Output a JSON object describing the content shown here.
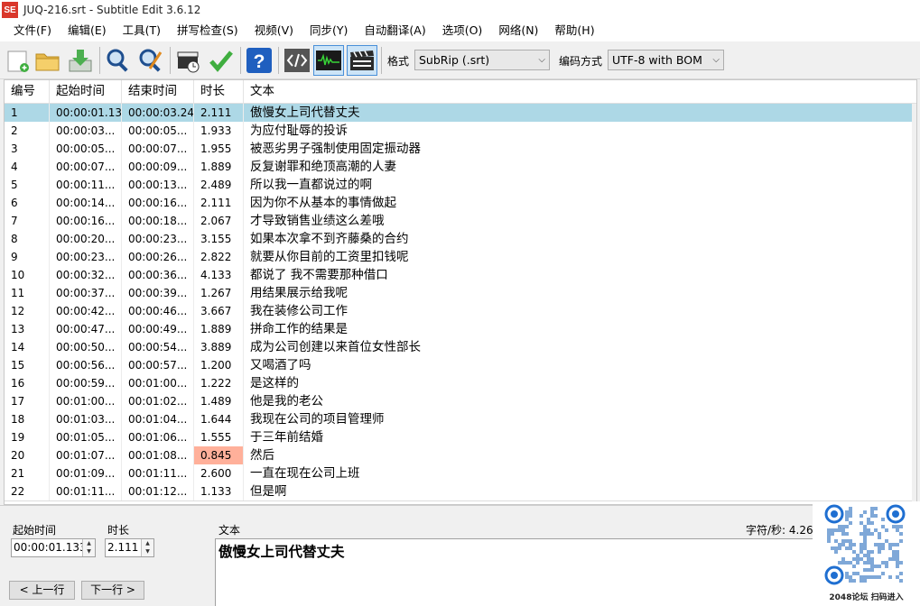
{
  "window": {
    "logo_text": "SE",
    "title": "JUQ-216.srt - Subtitle Edit 3.6.12"
  },
  "menu": [
    "文件(F)",
    "编辑(E)",
    "工具(T)",
    "拼写检查(S)",
    "视频(V)",
    "同步(Y)",
    "自动翻译(A)",
    "选项(O)",
    "网络(N)",
    "帮助(H)"
  ],
  "toolbar": {
    "buttons": [
      {
        "name": "new-file-icon"
      },
      {
        "name": "open-folder-icon"
      },
      {
        "name": "save-download-icon"
      },
      {
        "name": "find-icon"
      },
      {
        "name": "replace-icon"
      },
      {
        "name": "visual-sync-icon"
      },
      {
        "name": "spell-check-icon"
      },
      {
        "name": "help-icon"
      },
      {
        "name": "source-view-icon"
      },
      {
        "name": "waveform-icon"
      },
      {
        "name": "video-icon"
      }
    ],
    "format_label": "格式",
    "format_value": "SubRip (.srt)",
    "encoding_label": "编码方式",
    "encoding_value": "UTF-8 with BOM"
  },
  "grid": {
    "columns": [
      "编号",
      "起始时间",
      "结束时间",
      "时长",
      "文本"
    ],
    "rows": [
      [
        "1",
        "00:00:01.133",
        "00:00:03.244",
        "2.111",
        "傲慢女上司代替丈夫"
      ],
      [
        "2",
        "00:00:03...",
        "00:00:05...",
        "1.933",
        "为应付耻辱的投诉"
      ],
      [
        "3",
        "00:00:05...",
        "00:00:07...",
        "1.955",
        "被恶劣男子强制使用固定振动器"
      ],
      [
        "4",
        "00:00:07...",
        "00:00:09...",
        "1.889",
        "反复谢罪和绝顶高潮的人妻"
      ],
      [
        "5",
        "00:00:11...",
        "00:00:13...",
        "2.489",
        "所以我一直都说过的啊"
      ],
      [
        "6",
        "00:00:14...",
        "00:00:16...",
        "2.111",
        "因为你不从基本的事情做起"
      ],
      [
        "7",
        "00:00:16...",
        "00:00:18...",
        "2.067",
        "才导致销售业绩这么差哦"
      ],
      [
        "8",
        "00:00:20...",
        "00:00:23...",
        "3.155",
        "如果本次拿不到齐藤桑的合约"
      ],
      [
        "9",
        "00:00:23...",
        "00:00:26...",
        "2.822",
        "就要从你目前的工资里扣钱呢"
      ],
      [
        "10",
        "00:00:32...",
        "00:00:36...",
        "4.133",
        "都说了 我不需要那种借口"
      ],
      [
        "11",
        "00:00:37...",
        "00:00:39...",
        "1.267",
        "用结果展示给我呢"
      ],
      [
        "12",
        "00:00:42...",
        "00:00:46...",
        "3.667",
        "我在装修公司工作"
      ],
      [
        "13",
        "00:00:47...",
        "00:00:49...",
        "1.889",
        "拼命工作的结果是"
      ],
      [
        "14",
        "00:00:50...",
        "00:00:54...",
        "3.889",
        "成为公司创建以来首位女性部长"
      ],
      [
        "15",
        "00:00:56...",
        "00:00:57...",
        "1.200",
        "又喝酒了吗"
      ],
      [
        "16",
        "00:00:59...",
        "00:01:00...",
        "1.222",
        "是这样的"
      ],
      [
        "17",
        "00:01:00...",
        "00:01:02...",
        "1.489",
        "他是我的老公"
      ],
      [
        "18",
        "00:01:03...",
        "00:01:04...",
        "1.644",
        "我现在公司的项目管理师"
      ],
      [
        "19",
        "00:01:05...",
        "00:01:06...",
        "1.555",
        "于三年前结婚"
      ],
      [
        "20",
        "00:01:07...",
        "00:01:08...",
        "0.845",
        "然后"
      ],
      [
        "21",
        "00:01:09...",
        "00:01:11...",
        "2.600",
        "一直在现在公司上班"
      ],
      [
        "22",
        "00:01:11...",
        "00:01:12...",
        "1.133",
        "但是啊"
      ]
    ],
    "selected_row": 0,
    "warning_row": 19
  },
  "editor": {
    "start_label": "起始时间",
    "start_value": "00:00:01.133",
    "duration_label": "时长",
    "duration_value": "2.111",
    "text_label": "文本",
    "cps_label": "字符/秒: 4.26",
    "text_value": "傲慢女上司代替丈夫",
    "prev_button": "< 上一行",
    "next_button": "下一行 >"
  },
  "overlay": {
    "caption": "2048论坛 扫码进入"
  },
  "colors": {
    "selected_row": "#add8e6",
    "warning_cell": "#ffb09a",
    "logo": "#d9372b"
  }
}
